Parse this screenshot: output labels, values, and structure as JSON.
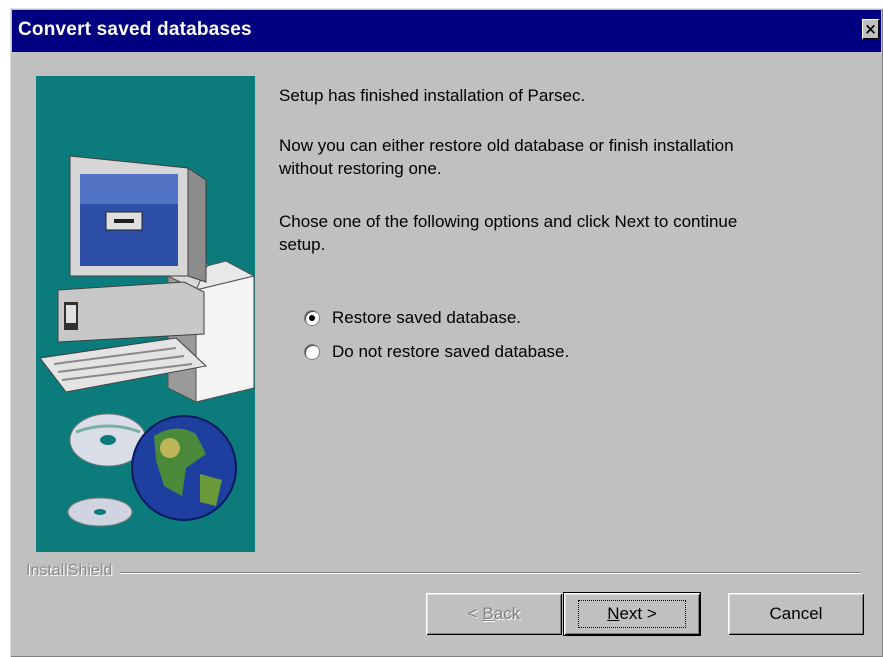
{
  "window": {
    "title": "Convert saved databases",
    "close_glyph": "×"
  },
  "content": {
    "line1": "Setup has finished installation of Parsec.",
    "line2a": "Now you can either restore old database or finish installation",
    "line2b": "without restoring one.",
    "line3a": "Chose one of the following options and click Next to continue",
    "line3b": "setup."
  },
  "options": [
    {
      "label": "Restore saved database.",
      "checked": true
    },
    {
      "label": "Do not restore saved database.",
      "checked": false
    }
  ],
  "footer": {
    "brand": "InstallShield"
  },
  "buttons": {
    "back_prefix": "< ",
    "back_mnemonic": "B",
    "back_rest": "ack",
    "next_mnemonic": "N",
    "next_rest": "ext >",
    "cancel": "Cancel"
  },
  "colors": {
    "titlebar": "#000080",
    "dialog": "#c0c0c0",
    "art_background": "#0c7b7b"
  },
  "icons": [
    "close-icon",
    "computer-illustration",
    "cd-icon",
    "globe-icon"
  ]
}
